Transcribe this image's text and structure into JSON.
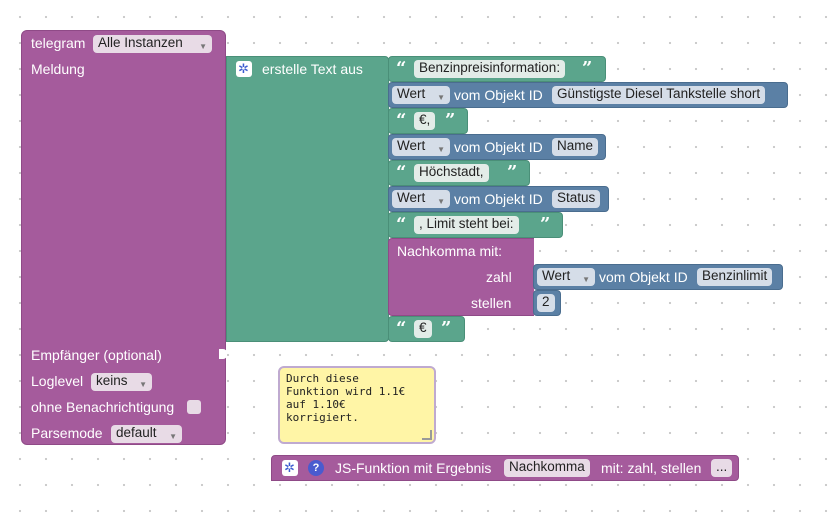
{
  "telegram_block": {
    "title": "telegram",
    "instance_value": "Alle Instanzen",
    "message_label": "Meldung",
    "recipient_label": "Empfänger (optional)",
    "loglevel_label": "Loglevel",
    "loglevel_value": "keins",
    "silent_label": "ohne Benachrichtigung",
    "parsemode_label": "Parsemode",
    "parsemode_value": "default"
  },
  "text_join": {
    "label": "erstelle Text aus"
  },
  "items": {
    "text1": "Benzinpreisinformation:",
    "state_prop": "Wert",
    "from_object": "vom Objekt ID",
    "obj1": "Günstigste Diesel Tankstelle short",
    "text2": "€,",
    "obj2": "Name",
    "text3": "Höchstadt,",
    "obj3": "Status",
    "text4": ", Limit steht bei:",
    "nachkomma_label": "Nachkomma  mit:",
    "zahl_label": "zahl",
    "obj4": "Benzinlimit",
    "stellen_label": "stellen",
    "stellen_value": "2",
    "text5": "€"
  },
  "comment": {
    "text": "Durch diese\nFunktion wird 1.1€\nauf 1.10€\nkorrigiert."
  },
  "function_def": {
    "label": "JS-Funktion mit Ergebnis",
    "name": "Nachkomma",
    "params": "mit: zahl, stellen",
    "more": "..."
  },
  "colors": {
    "purple": "#a55b9c",
    "teal": "#5ba58c",
    "blue": "#5b80a5"
  }
}
